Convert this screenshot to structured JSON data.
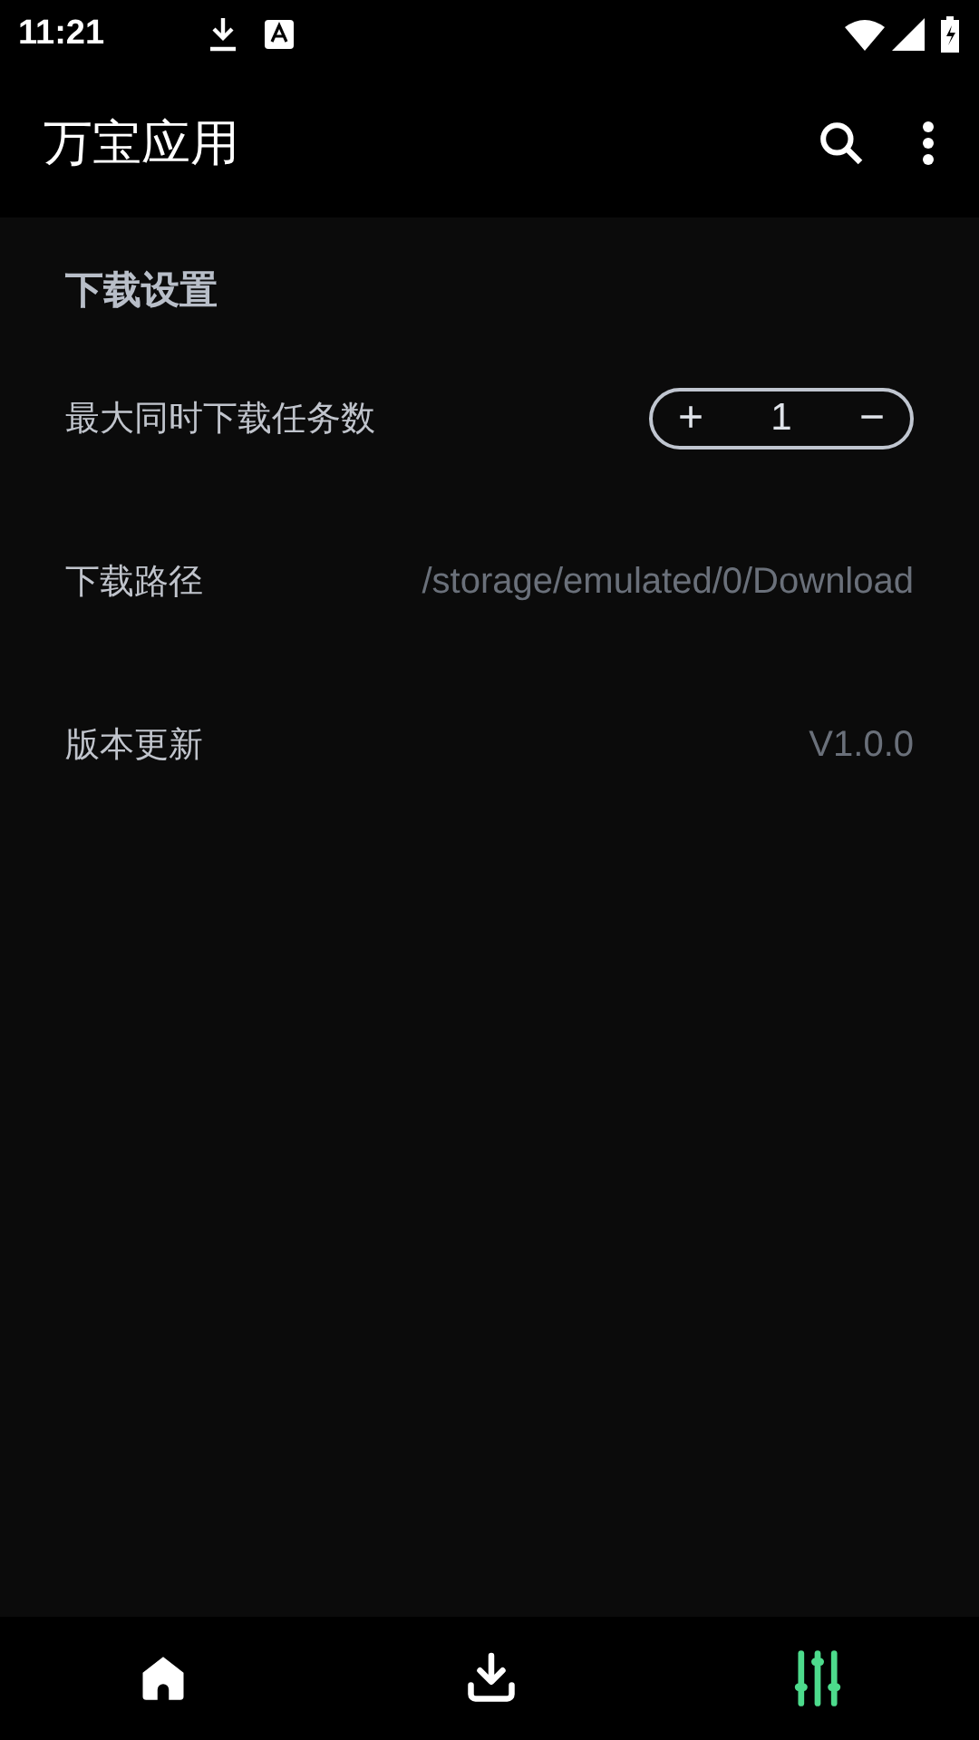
{
  "status_bar": {
    "time": "11:21"
  },
  "app_bar": {
    "title": "万宝应用"
  },
  "section": {
    "title": "下载设置"
  },
  "settings": [
    {
      "kind": "stepper",
      "label": "最大同时下载任务数",
      "increment": "+",
      "value": "1",
      "decrement": "−"
    },
    {
      "kind": "value",
      "label": "下载路径",
      "value": "/storage/emulated/0/Download"
    },
    {
      "kind": "value",
      "label": "版本更新",
      "value": "V1.0.0"
    }
  ],
  "nav": [
    {
      "kind": "home",
      "selected": false
    },
    {
      "kind": "downloads",
      "selected": false
    },
    {
      "kind": "settings",
      "selected": true
    }
  ]
}
